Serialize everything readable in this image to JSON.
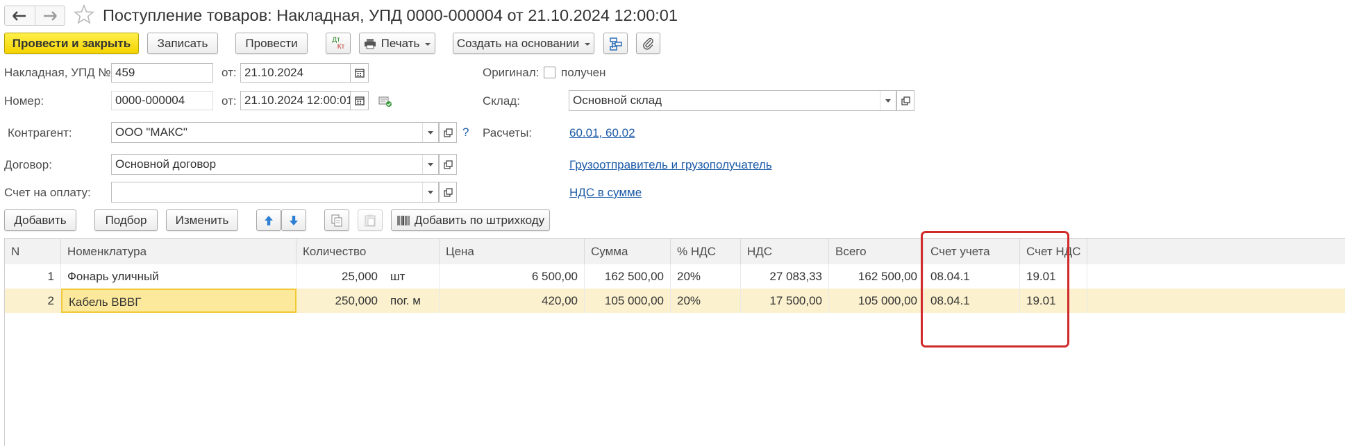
{
  "window": {
    "title": "Поступление товаров: Накладная, УПД 0000-000004 от 21.10.2024 12:00:01"
  },
  "toolbar": {
    "post_close": "Провести и закрыть",
    "save": "Записать",
    "post": "Провести",
    "dtkt_top": "Дт",
    "dtkt_bottom": "Кт",
    "print": "Печать",
    "create_based": "Создать на основании"
  },
  "form": {
    "invoice_label": "Накладная, УПД №:",
    "invoice_value": "459",
    "from_label": "от:",
    "invoice_date": "21.10.2024",
    "number_label": "Номер:",
    "number_value": "0000-000004",
    "number_date": "21.10.2024 12:00:01",
    "original_label": "Оригинал:",
    "original_checkbox_label": "получен",
    "original_checked": false,
    "warehouse_label": "Склад:",
    "warehouse_value": "Основной склад",
    "counterparty_label": "Контрагент:",
    "counterparty_value": "ООО \"МАКС\"",
    "help_mark": "?",
    "settlements_label": "Расчеты:",
    "settlements_link": "60.01, 60.02",
    "contract_label": "Договор:",
    "contract_value": "Основной договор",
    "consignor_link": "Грузоотправитель и грузополучатель",
    "payment_invoice_label": "Счет на оплату:",
    "payment_invoice_value": "",
    "vat_link": "НДС в сумме"
  },
  "table_toolbar": {
    "add": "Добавить",
    "pick": "Подбор",
    "edit": "Изменить",
    "barcode": "Добавить по штрихкоду"
  },
  "table": {
    "columns": [
      "N",
      "Номенклатура",
      "Количество",
      "Цена",
      "Сумма",
      "% НДС",
      "НДС",
      "Всего",
      "Счет учета",
      "Счет НДС"
    ],
    "rows": [
      {
        "n": "1",
        "item": "Фонарь уличный",
        "qty": "25,000",
        "unit": "шт",
        "price": "6 500,00",
        "sum": "162 500,00",
        "vat_rate": "20%",
        "vat": "27 083,33",
        "total": "162 500,00",
        "account": "08.04.1",
        "vat_account": "19.01"
      },
      {
        "n": "2",
        "item": "Кабель ВВВГ",
        "qty": "250,000",
        "unit": "пог. м",
        "price": "420,00",
        "sum": "105 000,00",
        "vat_rate": "20%",
        "vat": "17 500,00",
        "total": "105 000,00",
        "account": "08.04.1",
        "vat_account": "19.01"
      }
    ]
  },
  "colors": {
    "primary_button": "#f3d300",
    "selected_row": "#fbf1ce",
    "link": "#1c5ba8",
    "highlight_frame": "#d02a2a"
  }
}
